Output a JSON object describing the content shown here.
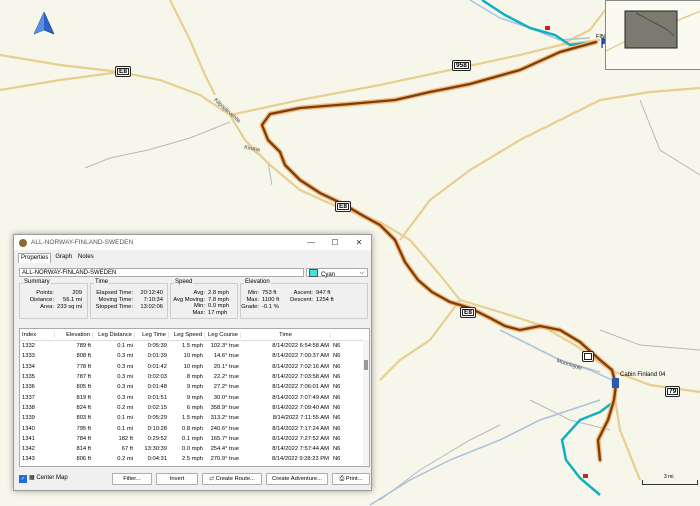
{
  "map": {
    "roads": {
      "e8_top": "E8",
      "r958": "958",
      "e8_mid": "E8",
      "e8_low": "E8",
      "r79": "79"
    },
    "labels": {
      "kiruna": "Kiruna",
      "muonio": "Muoniojoki",
      "road_label": "Kilpisjärventie",
      "cabin": "Cabin Finland 04",
      "fin": "FIN",
      "scale_text": "3 mi"
    },
    "colors": {
      "track": "#8a4a10",
      "track_glow": "#f0b070",
      "cyan_track": "#10b0c0",
      "water": "#9ab8d8",
      "road": "#e8d098"
    }
  },
  "window": {
    "title": "ALL-NORWAY-FINLAND-SWEDEN",
    "controls": {
      "min": "—",
      "max": "☐",
      "close": "✕"
    },
    "tabs": [
      "Properties",
      "Graph",
      "Notes"
    ],
    "name_value": "ALL-NORWAY-FINLAND-SWEDEN",
    "color_value": "Cyan",
    "summary": {
      "title": "Summary",
      "points_label": "Points:",
      "points": "209",
      "distance_label": "Distance:",
      "distance": "56.1 mi",
      "area_label": "Area:",
      "area": "233 sq mi"
    },
    "time": {
      "title": "Time",
      "elapsed_label": "Elapsed Time:",
      "elapsed": "20:12:40",
      "moving_label": "Moving Time:",
      "moving": "7:10:34",
      "stopped_label": "Stopped Time:",
      "stopped": "13:02:06"
    },
    "speed": {
      "title": "Speed",
      "avg_label": "Avg:",
      "avg": "2.8 mph",
      "avg_moving_label": "Avg Moving:",
      "avg_moving": "7.8 mph",
      "min_label": "Min:",
      "min": "0.0 mph",
      "max_label": "Max:",
      "max": "17 mph"
    },
    "elevation": {
      "title": "Elevation",
      "min_label": "Min:",
      "min": "753 ft",
      "max_label": "Max:",
      "max": "1100 ft",
      "grade_label": "Grade:",
      "grade": "-0.1 %",
      "ascent_label": "Ascent:",
      "ascent": "947 ft",
      "descent_label": "Descent:",
      "descent": "1254 ft"
    },
    "table": {
      "headers": [
        "Index",
        "Elevation",
        "Leg Distance",
        "Leg Time",
        "Leg Speed",
        "Leg Course",
        "Time",
        ""
      ],
      "rows": [
        [
          "1332",
          "789 ft",
          "0.1 mi",
          "0:05:39",
          "1.5 mph",
          "102.3° true",
          "8/14/2022 6:54:58 AM",
          "N6"
        ],
        [
          "1333",
          "808 ft",
          "0.3 mi",
          "0:01:39",
          "10 mph",
          "14.6° true",
          "8/14/2022 7:00:37 AM",
          "N6"
        ],
        [
          "1334",
          "778 ft",
          "0.3 mi",
          "0:01:42",
          "10 mph",
          "20.1° true",
          "8/14/2022 7:02:16 AM",
          "N6"
        ],
        [
          "1335",
          "787 ft",
          "0.3 mi",
          "0:02:03",
          "8 mph",
          "22.2° true",
          "8/14/2022 7:03:58 AM",
          "N6"
        ],
        [
          "1336",
          "805 ft",
          "0.3 mi",
          "0:01:48",
          "9 mph",
          "27.2° true",
          "8/14/2022 7:06:01 AM",
          "N6"
        ],
        [
          "1337",
          "819 ft",
          "0.3 mi",
          "0:01:51",
          "9 mph",
          "30.0° true",
          "8/14/2022 7:07:49 AM",
          "N6"
        ],
        [
          "1338",
          "824 ft",
          "0.2 mi",
          "0:02:15",
          "6 mph",
          "358.9° true",
          "8/14/2022 7:09:40 AM",
          "N6"
        ],
        [
          "1339",
          "803 ft",
          "0.1 mi",
          "0:05:29",
          "1.5 mph",
          "313.2° true",
          "8/14/2022 7:11:55 AM",
          "N6"
        ],
        [
          "1340",
          "795 ft",
          "0.1 mi",
          "0:10:28",
          "0.8 mph",
          "240.6° true",
          "8/14/2022 7:17:24 AM",
          "N6"
        ],
        [
          "1341",
          "784 ft",
          "182 ft",
          "0:29:52",
          "0.1 mph",
          "165.7° true",
          "8/14/2022 7:27:52 AM",
          "N6"
        ],
        [
          "1342",
          "814 ft",
          "67 ft",
          "13:30:39",
          "0.0 mph",
          "254.4° true",
          "8/14/2022 7:57:44 AM",
          "N6"
        ],
        [
          "1343",
          "806 ft",
          "0.2 mi",
          "0:04:31",
          "2.5 mph",
          "270.9° true",
          "8/14/2022 9:28:23 PM",
          "N6"
        ]
      ]
    },
    "bottom": {
      "center_map": "Center Map",
      "filter": "Filter...",
      "invert": "Invert",
      "create_route": "Create Route...",
      "create_adventure": "Create Adventure...",
      "print": "Print..."
    }
  }
}
